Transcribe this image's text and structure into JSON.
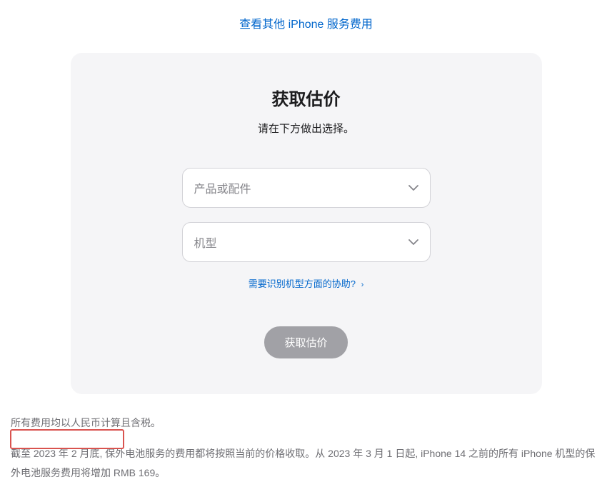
{
  "topLink": {
    "label": "查看其他 iPhone 服务费用"
  },
  "card": {
    "title": "获取估价",
    "subtitle": "请在下方做出选择。",
    "select1": {
      "placeholder": "产品或配件"
    },
    "select2": {
      "placeholder": "机型"
    },
    "helpLink": {
      "label": "需要识别机型方面的协助?"
    },
    "submitButton": {
      "label": "获取估价"
    }
  },
  "footer": {
    "line1": "所有费用均以人民币计算且含税。",
    "line2": "截至 2023 年 2 月底, 保外电池服务的费用都将按照当前的价格收取。从 2023 年 3 月 1 日起, iPhone 14 之前的所有 iPhone 机型的保外电池服务费用将增加 RMB 169。"
  }
}
